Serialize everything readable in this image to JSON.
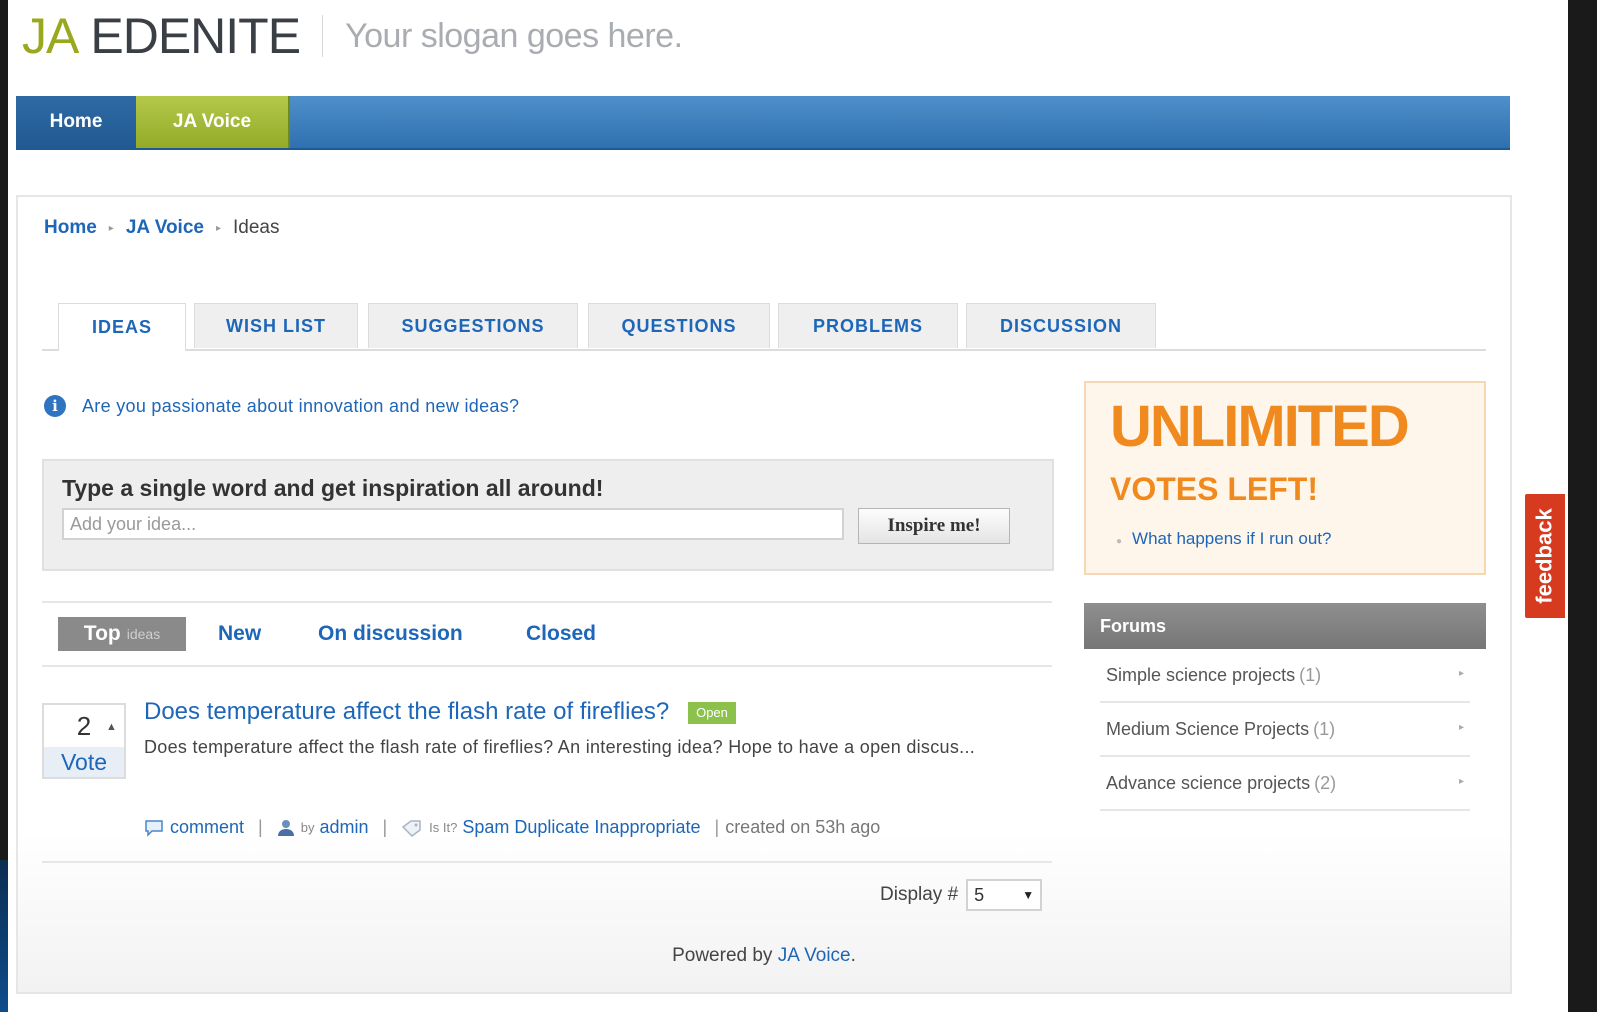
{
  "header": {
    "logo_ja": "JA",
    "logo_name": "EDENITE",
    "slogan": "Your slogan goes here."
  },
  "main_nav": [
    {
      "label": "Home"
    },
    {
      "label": "JA Voice"
    }
  ],
  "breadcrumb": {
    "items": [
      "Home",
      "JA Voice"
    ],
    "current": "Ideas"
  },
  "tabs": [
    "IDEAS",
    "WISH LIST",
    "SUGGESTIONS",
    "QUESTIONS",
    "PROBLEMS",
    "DISCUSSION"
  ],
  "info": {
    "text": "Are you passionate about innovation and new ideas?"
  },
  "inspire": {
    "title": "Type a single word and get inspiration all around!",
    "placeholder": "Add your idea...",
    "button": "Inspire me!"
  },
  "filters": {
    "top": "Top",
    "top_small": "ideas",
    "new": "New",
    "on_discussion": "On discussion",
    "closed": "Closed"
  },
  "idea": {
    "votes": "2",
    "vote_label": "Vote",
    "title": "Does temperature affect the flash rate of fireflies?",
    "status": "Open",
    "description": "Does temperature affect the flash rate of fireflies? An interesting idea? Hope to have a open discus...",
    "comment": "comment",
    "by": "by",
    "author": "admin",
    "is_it": "Is It?",
    "flags": "Spam Duplicate Inappropriate",
    "created": "created on 53h ago"
  },
  "display": {
    "label": "Display #",
    "value": "5"
  },
  "footer": {
    "powered_by": "Powered by",
    "link": "JA Voice",
    "period": "."
  },
  "votes_box": {
    "big": "UNLIMITED",
    "sub": "VOTES LEFT!",
    "help": "What happens if I run out?"
  },
  "forums": {
    "title": "Forums",
    "items": [
      {
        "name": "Simple science projects",
        "count": "(1)"
      },
      {
        "name": "Medium Science Projects",
        "count": "(1)"
      },
      {
        "name": "Advance science projects",
        "count": "(2)"
      }
    ]
  },
  "feedback": "feedback",
  "colors": {
    "link": "#1d66b8",
    "nav_blue": "#2f70b0",
    "nav_green": "#93ab27",
    "orange": "#f08a1e",
    "feedback_red": "#d63b20"
  }
}
